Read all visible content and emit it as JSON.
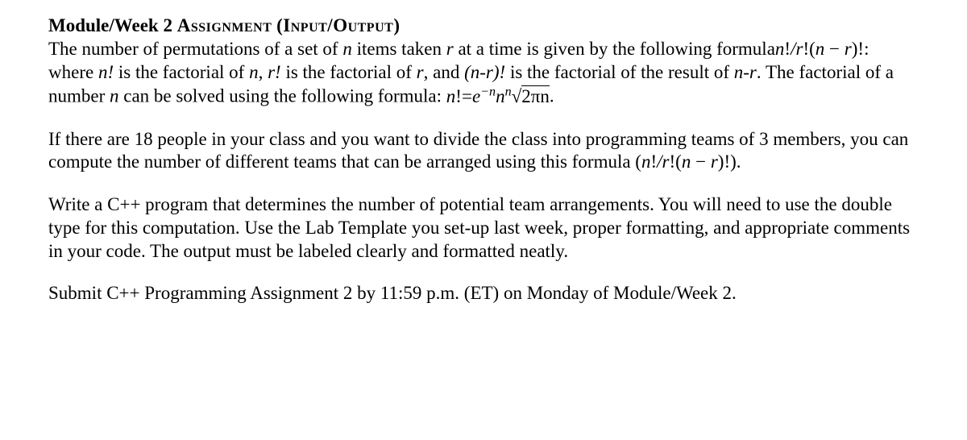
{
  "title": {
    "module": "Module/Week 2 ",
    "assignment": "Assignment",
    "spacer": "  ",
    "paren_open": "(",
    "paren_text": "Input/Output",
    "paren_close": ")"
  },
  "para1": {
    "t1": "The number of permutations of a set of ",
    "n1": "n",
    "t2": " items taken ",
    "r1": "r",
    "t3": " at a time is given by the following formula",
    "f1_a": "n",
    "f1_b": "!",
    "f1_c": "/",
    "f1_d": "r",
    "f1_e": "!",
    "f1_f": "(",
    "f1_g": "n",
    "f1_h": " − ",
    "f1_i": "r",
    "f1_j": ")",
    "f1_k": "!",
    "t4": ": where ",
    "nf": "n!",
    "t5": " is the factorial of ",
    "n2": "n",
    "t6": ", ",
    "rf": "r!",
    "t7": " is the factorial of ",
    "r2": "r",
    "t8": ", and ",
    "nmrf": "(n-r)!",
    "t9": " is the factorial of the result of ",
    "nmr": "n-r",
    "t10": ". The factorial of a number ",
    "n3": "n",
    "t11": " can be solved using the following formula: ",
    "f2_a": "n",
    "f2_b": "!",
    "f2_c": "=",
    "f2_d": "e",
    "f2_e": "−n",
    "f2_f": "n",
    "f2_g": "n",
    "f2_h": "√",
    "f2_i": "2",
    "f2_j": "πn",
    "t12": "."
  },
  "para2": {
    "t1": "If there are 18 people in your class and you want to divide the class into programming teams of 3 members, you can compute the number of different teams that can be arranged using this formula (",
    "f_a": "n",
    "f_b": "!",
    "f_c": "/",
    "f_d": "r",
    "f_e": "!",
    "f_f": "(",
    "f_g": "n",
    "f_h": " − ",
    "f_i": "r",
    "f_j": ")",
    "f_k": "!",
    "t2": ")."
  },
  "para3": {
    "text": "Write a C++ program that determines the number of potential team arrangements. You will need to use the double type for this computation. Use the Lab Template you set-up last week, proper formatting, and appropriate comments in your code. The output must be labeled clearly and formatted neatly."
  },
  "para4": {
    "text": "Submit C++ Programming Assignment 2 by 11:59 p.m. (ET) on Monday of Module/Week 2."
  }
}
